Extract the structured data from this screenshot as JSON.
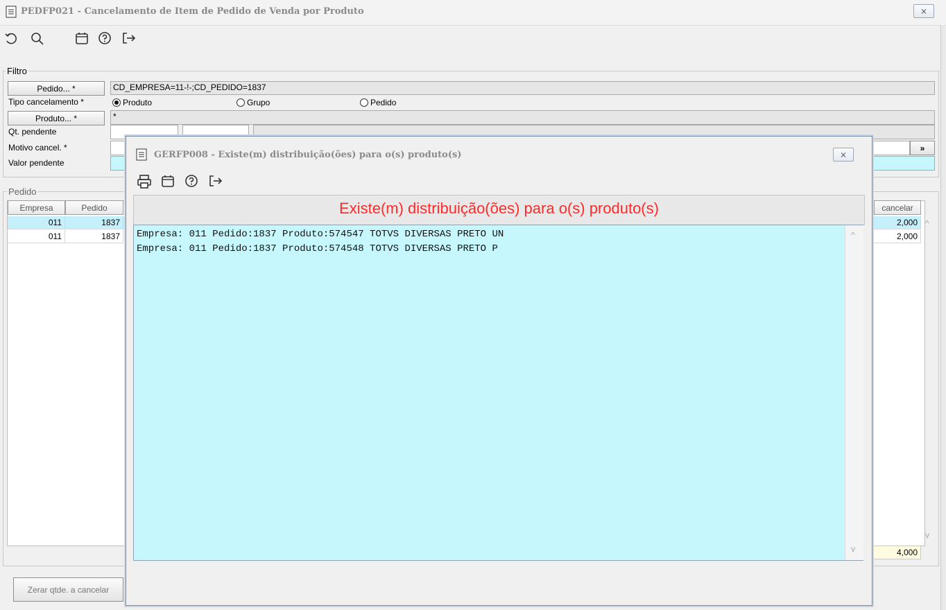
{
  "window": {
    "title": "PEDFP021 - Cancelamento de Item de Pedido de Venda por Produto",
    "close_label": "⨯"
  },
  "toolbar": {
    "icons": [
      "undo-icon",
      "search-icon",
      "calendar-icon",
      "help-icon",
      "exit-icon"
    ]
  },
  "filtro": {
    "legend": "Filtro",
    "pedido_button": "Pedido... *",
    "pedido_value": "CD_EMPRESA=11-!-;CD_PEDIDO=1837",
    "tipo_label": "Tipo cancelamento *",
    "radio_produto": "Produto",
    "radio_grupo": "Grupo",
    "radio_pedido": "Pedido",
    "radio_selected": "Produto",
    "produto_button": "Produto... *",
    "produto_value": "*",
    "qt_label": "Qt. pendente",
    "motivo_label": "Motivo cancel. *",
    "valor_label": "Valor pendente",
    "more_button": "»"
  },
  "pedido": {
    "legend": "Pedido",
    "columns": [
      "Empresa",
      "Pedido"
    ],
    "right_column": "cancelar",
    "rows": [
      {
        "empresa": "011",
        "pedido": "1837",
        "cancelar": "2,000"
      },
      {
        "empresa": "011",
        "pedido": "1837",
        "cancelar": "2,000"
      }
    ],
    "total": "4,000"
  },
  "footer": {
    "zerar_button": "Zerar qtde. a cancelar"
  },
  "modal": {
    "title": "GERFP008 - Existe(m) distribuição(ões) para o(s) produto(s)",
    "close_label": "⨯",
    "toolbar_icons": [
      "print-icon",
      "calendar-icon",
      "help-icon",
      "exit-icon"
    ],
    "banner": "Existe(m) distribuição(ões) para o(s) produto(s)",
    "lines": [
      "Empresa: 011 Pedido:1837 Produto:574547 TOTVS DIVERSAS PRETO UN",
      "Empresa: 011 Pedido:1837 Produto:574548 TOTVS DIVERSAS PRETO P"
    ]
  },
  "colors": {
    "banner": "#ff2a2a",
    "listing_bg": "#c5f7fd",
    "selected_row": "#c5f0fb"
  }
}
